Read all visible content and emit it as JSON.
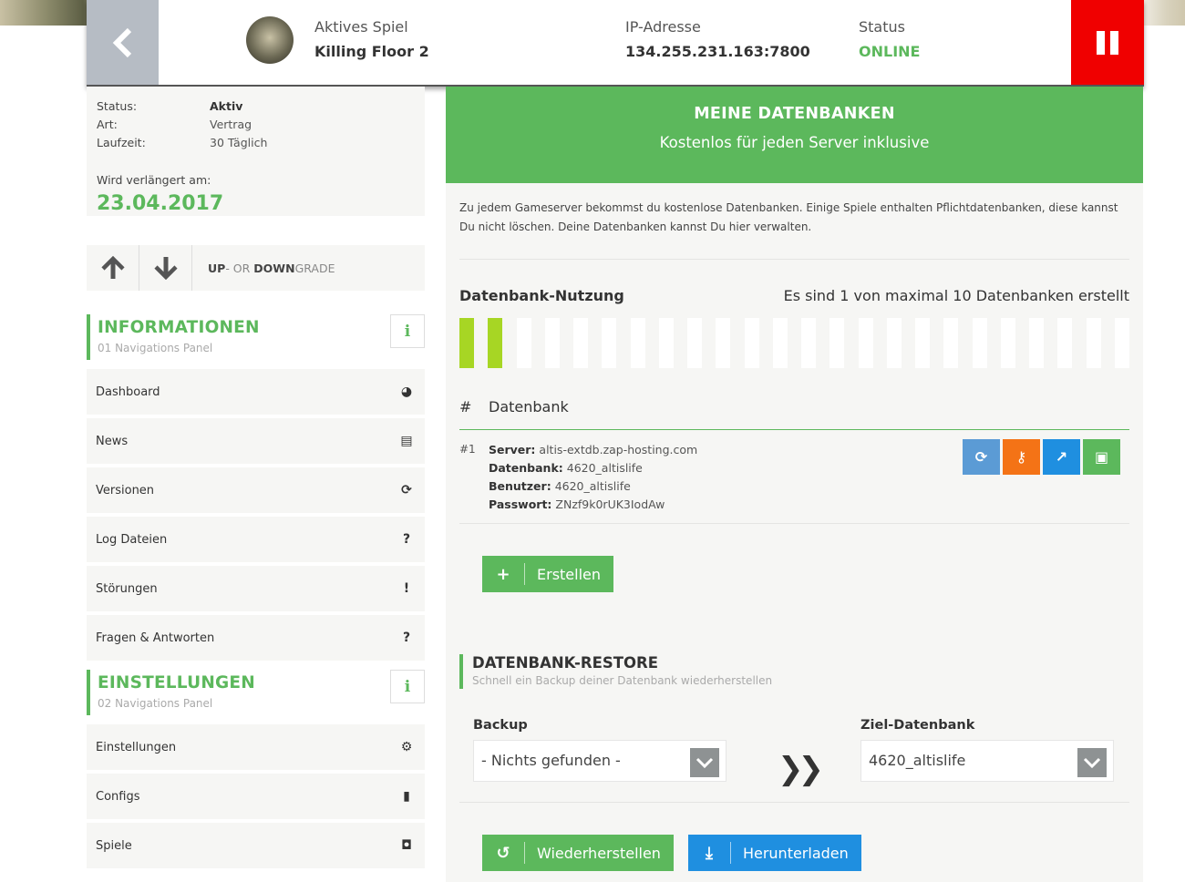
{
  "header": {
    "active_game_label": "Aktives Spiel",
    "active_game_value": "Killing Floor 2",
    "ip_label": "IP-Adresse",
    "ip_value": "134.255.231.163:7800",
    "status_label": "Status",
    "status_value": "ONLINE"
  },
  "server_info": {
    "rows": [
      {
        "key": "Status:",
        "value": "Aktiv"
      },
      {
        "key": "Art:",
        "value": "Vertrag"
      },
      {
        "key": "Laufzeit:",
        "value": "30 Täglich"
      }
    ],
    "renew_label": "Wird verlängert am:",
    "renew_date": "23.04.2017",
    "upgrade_up": "UP",
    "upgrade_or": "- OR ",
    "upgrade_down": "DOWN",
    "upgrade_grade": "GRADE"
  },
  "sections": [
    {
      "title": "INFORMATIONEN",
      "subtitle": "01 Navigations Panel",
      "items": [
        {
          "label": "Dashboard",
          "icon": "gauge-icon"
        },
        {
          "label": "News",
          "icon": "newspaper-icon"
        },
        {
          "label": "Versionen",
          "icon": "refresh-icon"
        },
        {
          "label": "Log Dateien",
          "icon": "question-icon"
        },
        {
          "label": "Störungen",
          "icon": "exclamation-icon"
        },
        {
          "label": "Fragen & Antworten",
          "icon": "question-icon"
        }
      ]
    },
    {
      "title": "EINSTELLUNGEN",
      "subtitle": "02 Navigations Panel",
      "items": [
        {
          "label": "Einstellungen",
          "icon": "gears-icon"
        },
        {
          "label": "Configs",
          "icon": "file-icon"
        },
        {
          "label": "Spiele",
          "icon": "gamepad-icon"
        }
      ]
    }
  ],
  "main": {
    "hero_title": "MEINE DATENBANKEN",
    "hero_subtitle": "Kostenlos für jeden Server inklusive",
    "description": "Zu jedem Gameserver bekommst du kostenlose Datenbanken. Einige Spiele enthalten Pflichtdatenbanken, diese kannst Du nicht löschen. Deine Datenbanken kannst Du hier verwalten.",
    "usage_title": "Datenbank-Nutzung",
    "usage_info": "Es sind 1 von maximal 10 Datenbanken erstellt",
    "usage_bar_total": 24,
    "usage_bar_used": 2,
    "table_hash": "#",
    "table_col": "Datenbank",
    "databases": [
      {
        "num": "#1",
        "server_label": "Server:",
        "server": "altis-extdb.zap-hosting.com",
        "db_label": "Datenbank:",
        "db": "4620_altislife",
        "user_label": "Benutzer:",
        "user": "4620_altislife",
        "pass_label": "Passwort:",
        "pass": "ZNzf9k0rUK3IodAw"
      }
    ],
    "create_label": "Erstellen",
    "restore_title": "DATENBANK-RESTORE",
    "restore_subtitle": "Schnell ein Backup deiner Datenbank wiederherstellen",
    "backup_label": "Backup",
    "backup_value": "- Nichts gefunden -",
    "target_label": "Ziel-Datenbank",
    "target_value": "4620_altislife",
    "restore_btn": "Wiederherstellen",
    "download_btn": "Herunterladen"
  }
}
